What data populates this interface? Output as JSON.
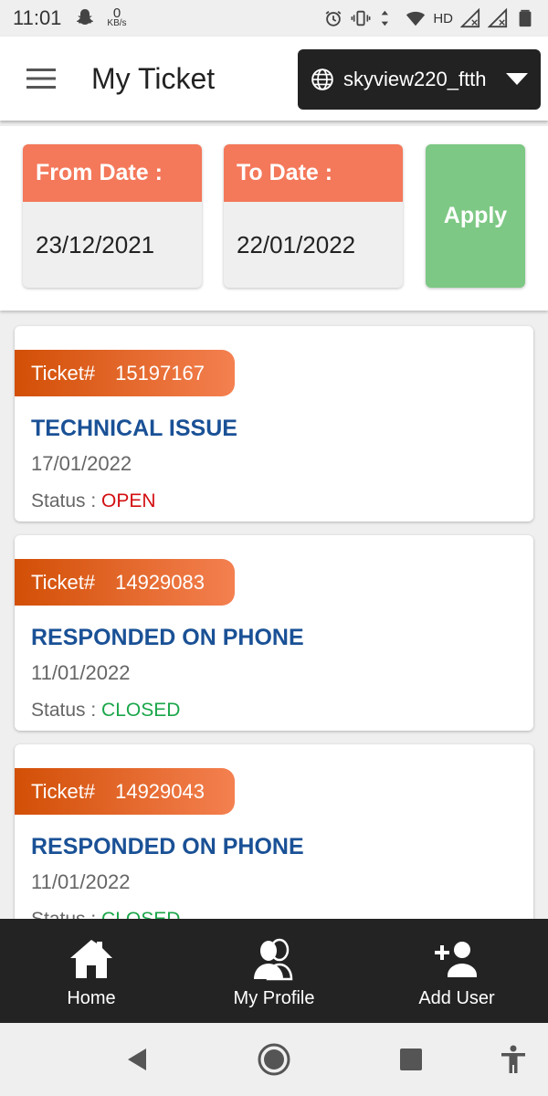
{
  "status_bar": {
    "time": "11:01",
    "data_rate_value": "0",
    "data_rate_unit": "KB/s",
    "network_label": "HD"
  },
  "header": {
    "title": "My Ticket",
    "account": "skyview220_ftth"
  },
  "filter": {
    "from_label": "From Date :",
    "from_value": "23/12/2021",
    "to_label": "To Date :",
    "to_value": "22/01/2022",
    "apply_label": "Apply"
  },
  "tickets": [
    {
      "ticket_label": "Ticket#",
      "number": "15197167",
      "title": "TECHNICAL ISSUE",
      "date": "17/01/2022",
      "status_label": "Status :",
      "status": "OPEN"
    },
    {
      "ticket_label": "Ticket#",
      "number": "14929083",
      "title": "RESPONDED ON PHONE",
      "date": "11/01/2022",
      "status_label": "Status :",
      "status": "CLOSED"
    },
    {
      "ticket_label": "Ticket#",
      "number": "14929043",
      "title": "RESPONDED ON PHONE",
      "date": "11/01/2022",
      "status_label": "Status :",
      "status": "CLOSED"
    }
  ],
  "bottom_nav": {
    "home": "Home",
    "profile": "My Profile",
    "add_user": "Add User"
  },
  "colors": {
    "accent_orange": "#f4785a",
    "apply_green": "#7dc884",
    "title_blue": "#1a5196",
    "open_red": "#d30f12",
    "closed_green": "#1aa64a",
    "nav_dark": "#232323"
  },
  "icons": {
    "menu": "hamburger-menu-icon",
    "account": "globe-icon",
    "dropdown": "caret-down-icon",
    "home": "home-icon",
    "profile": "people-icon",
    "add_user": "add-person-icon"
  }
}
